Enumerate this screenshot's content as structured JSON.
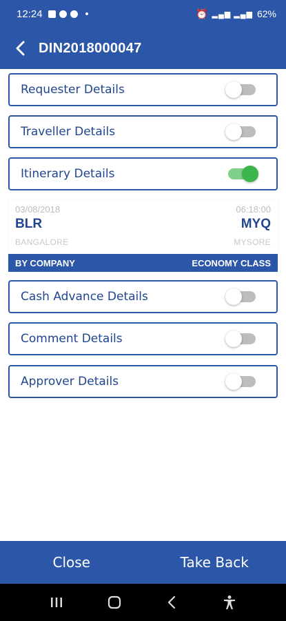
{
  "status_bar": {
    "time": "12:24",
    "battery": "62%"
  },
  "header": {
    "title": "DIN2018000047"
  },
  "sections": [
    {
      "label": "Requester Details",
      "enabled": false
    },
    {
      "label": "Traveller Details",
      "enabled": false
    },
    {
      "label": "Itinerary Details",
      "enabled": true
    },
    {
      "label": "Cash Advance Details",
      "enabled": false
    },
    {
      "label": "Comment Details",
      "enabled": false
    },
    {
      "label": "Approver Details",
      "enabled": false
    }
  ],
  "itinerary": {
    "date": "03/08/2018",
    "time": "06:18:00",
    "from_code": "BLR",
    "to_code": "MYQ",
    "from_city": "BANGALORE",
    "to_city": "MYSORE",
    "booked_by": "BY COMPANY",
    "class": "ECONOMY CLASS"
  },
  "actions": {
    "close": "Close",
    "take_back": "Take Back"
  },
  "colors": {
    "primary": "#2c57a8",
    "toggle_on": "#3cb54a",
    "toggle_off": "#bdbdbd"
  }
}
